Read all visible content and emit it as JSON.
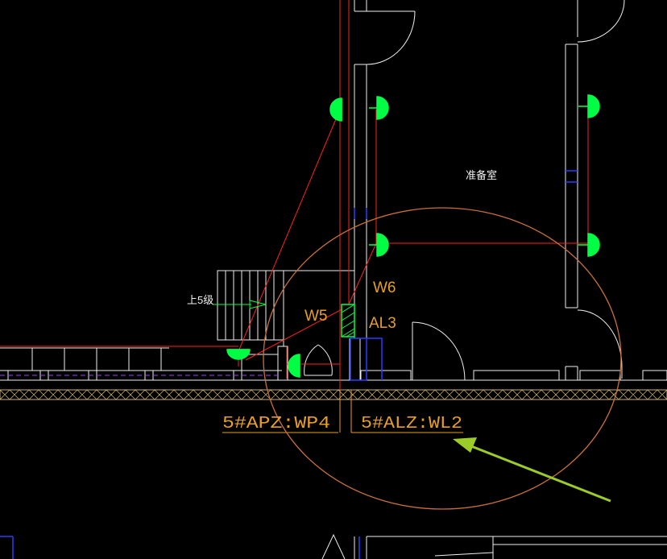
{
  "labels": {
    "room": "准备室",
    "stairs": "上5级",
    "circuit_w5": "W5",
    "circuit_w6": "W6",
    "panel": "AL3",
    "feeder_left": "5#APZ:WP4",
    "feeder_right": "5#ALZ:WL2"
  },
  "colors": {
    "background": "#000000",
    "wall": "#ffffff",
    "wire": "#ff2020",
    "fixture": "#00ff44",
    "annotation": "#e8a020",
    "highlight_ellipse": "#c8703a",
    "arrow": "#9ccc28",
    "blue": "#2a3cff",
    "purple": "#a040ff",
    "hatch_band": "#c8b070"
  }
}
